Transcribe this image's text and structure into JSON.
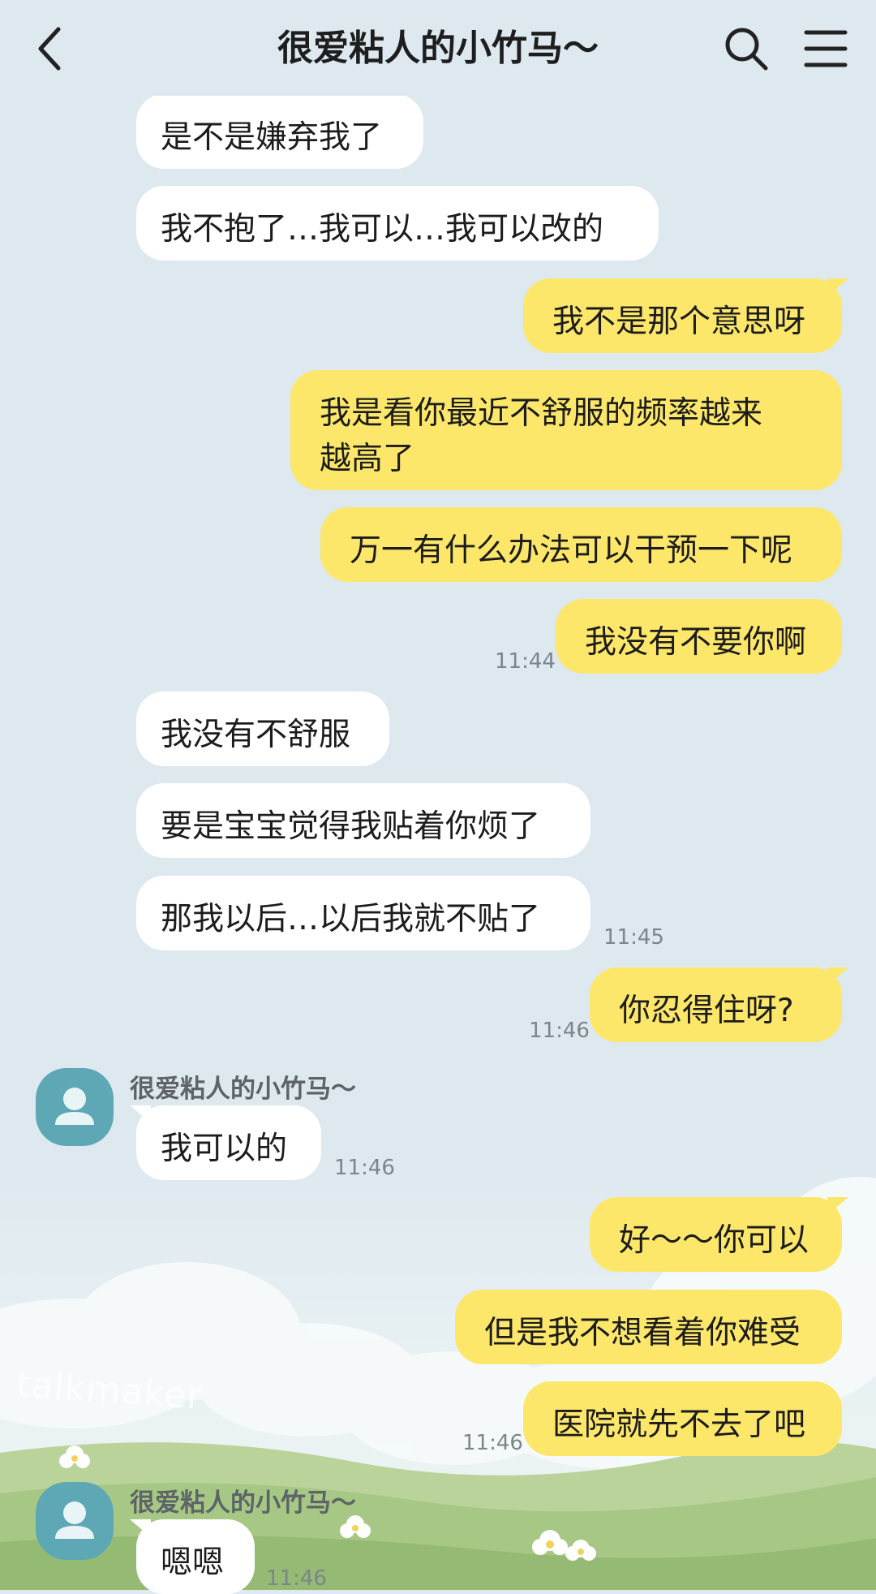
{
  "header": {
    "title": "很爱粘人的小竹马～"
  },
  "contact": {
    "name": "很爱粘人的小竹马～"
  },
  "messages": [
    {
      "side": "left",
      "text": "是不是嫌弃我了"
    },
    {
      "side": "left",
      "text": "我不抱了…我可以…我可以改的"
    },
    {
      "side": "right",
      "text": "我不是那个意思呀"
    },
    {
      "side": "right",
      "line1": "我是看你最近不舒服的频率越来",
      "line2": "越高了"
    },
    {
      "side": "right",
      "text": "万一有什么办法可以干预一下呢"
    },
    {
      "side": "right",
      "text": "我没有不要你啊",
      "time": "11:44"
    },
    {
      "side": "left",
      "text": "我没有不舒服"
    },
    {
      "side": "left",
      "text": "要是宝宝觉得我贴着你烦了"
    },
    {
      "side": "left",
      "text": "那我以后…以后我就不贴了",
      "time": "11:45"
    },
    {
      "side": "right",
      "text": "你忍得住呀?",
      "time": "11:46"
    },
    {
      "side": "left",
      "sender": "很爱粘人的小竹马～",
      "text": "我可以的",
      "time": "11:46"
    },
    {
      "side": "right",
      "text": "好～～你可以"
    },
    {
      "side": "right",
      "text": "但是我不想看着你难受"
    },
    {
      "side": "right",
      "text": "医院就先不去了吧",
      "time": "11:46"
    },
    {
      "side": "left",
      "sender": "很爱粘人的小竹马～",
      "text": "嗯嗯",
      "time": "11:46"
    }
  ],
  "watermark": "talkmaker",
  "colors": {
    "background": "#dde8ef",
    "sent_bubble": "#fce76a",
    "received_bubble": "#ffffff",
    "avatar": "#5ea7b4"
  },
  "icons": [
    "back-arrow-icon",
    "search-icon",
    "menu-icon",
    "person-icon"
  ]
}
